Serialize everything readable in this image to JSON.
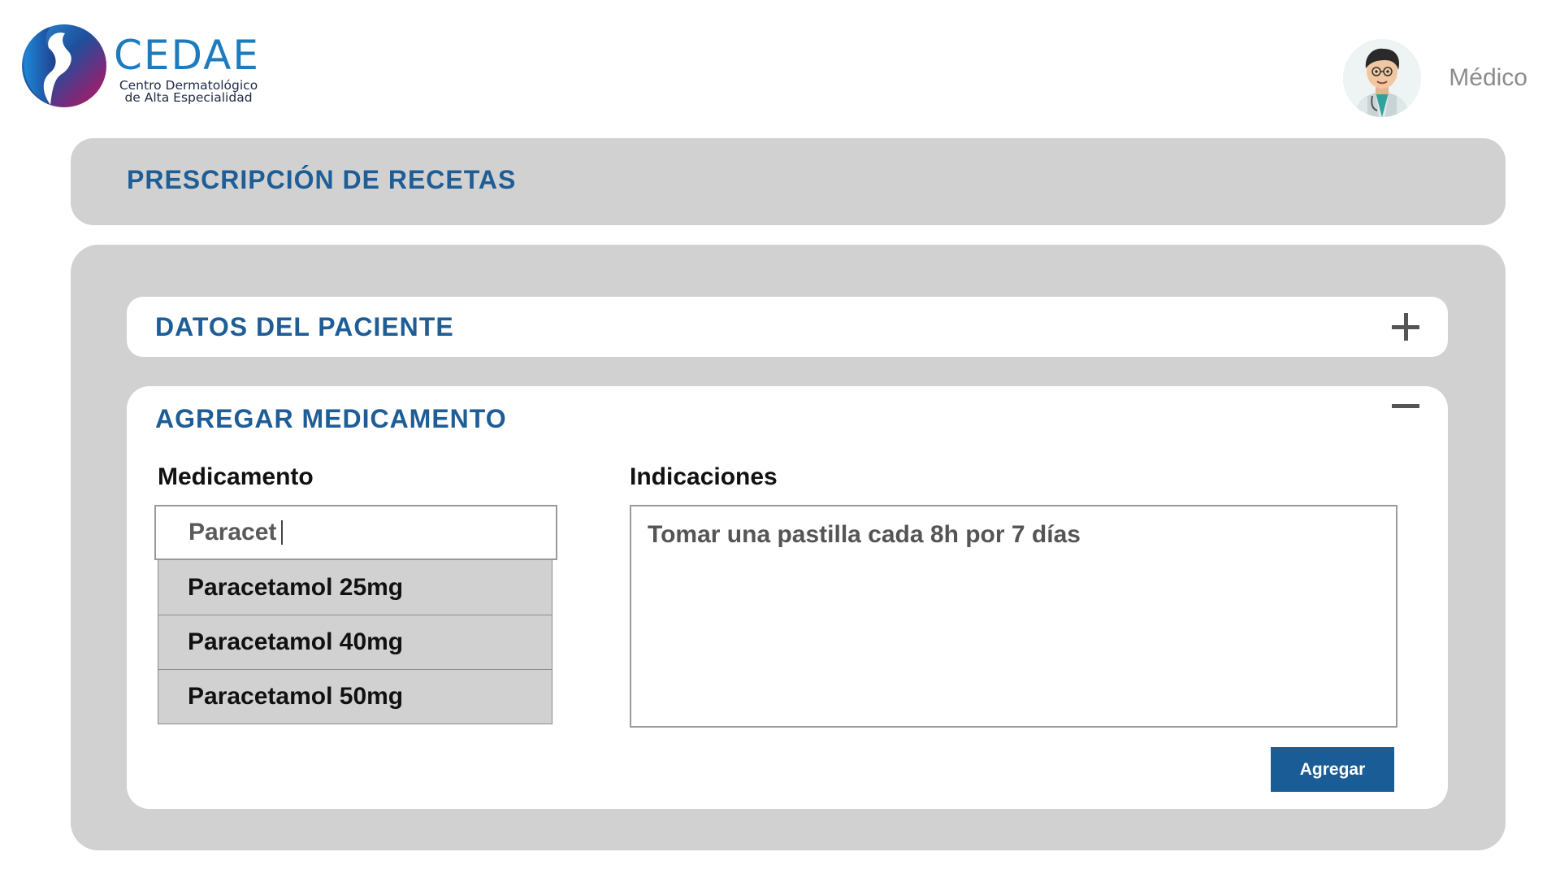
{
  "brand": {
    "name": "CEDAE",
    "subtitle_line1": "Centro Dermatológico",
    "subtitle_line2": "de Alta Especialidad"
  },
  "user": {
    "role": "Médico",
    "avatar_icon": "doctor-avatar-icon"
  },
  "page": {
    "title": "PRESCRIPCIÓN DE RECETAS"
  },
  "sections": {
    "patient": {
      "title": "DATOS DEL PACIENTE",
      "toggle_icon": "plus-icon",
      "expanded": false
    },
    "medication": {
      "title": "AGREGAR MEDICAMENTO",
      "toggle_icon": "minus-icon",
      "expanded": true,
      "med_label": "Medicamento",
      "med_value": "Paracet",
      "suggestions": [
        "Paracetamol 25mg",
        "Paracetamol 40mg",
        "Paracetamol 50mg"
      ],
      "indications_label": "Indicaciones",
      "indications_value": "Tomar una pastilla cada 8h por 7 días",
      "add_button": "Agregar"
    }
  },
  "colors": {
    "accent": "#1e5d96",
    "button": "#1a5c95",
    "panel": "#d1d1d1",
    "logo_text": "#1d7bbf"
  }
}
